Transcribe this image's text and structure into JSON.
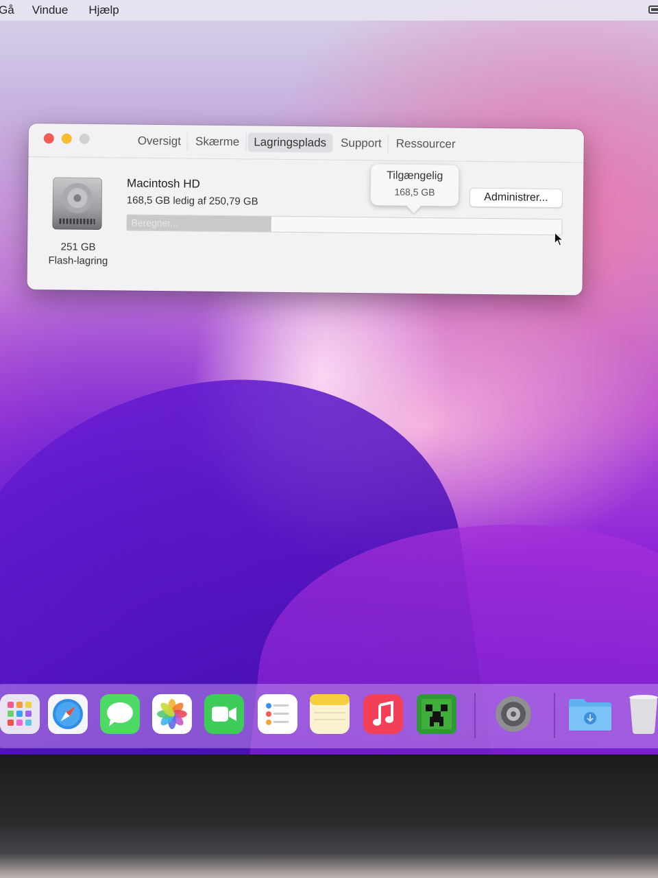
{
  "menubar": {
    "items": [
      "Gå",
      "Vindue",
      "Hjælp"
    ]
  },
  "window": {
    "tabs": [
      "Oversigt",
      "Skærme",
      "Lagringsplads",
      "Support",
      "Ressourcer"
    ],
    "active_tab": "Lagringsplads",
    "disk": {
      "icon": "hard-drive-icon",
      "capacity": "251 GB",
      "type": "Flash-lagring"
    },
    "volume": {
      "name": "Macintosh HD",
      "free_text": "168,5 GB ledig af 250,79 GB",
      "bar_label": "Beregner...",
      "used_fraction": 0.33
    },
    "tooltip": {
      "title": "Tilgængelig",
      "value": "168,5 GB"
    },
    "manage_button": "Administrer..."
  },
  "dock": {
    "items": [
      "launchpad-icon",
      "safari-icon",
      "messages-icon",
      "photos-icon",
      "facetime-icon",
      "reminders-icon",
      "notes-icon",
      "music-icon",
      "minecraft-icon",
      "system-preferences-icon",
      "downloads-folder-icon",
      "trash-icon"
    ]
  },
  "colors": {
    "close": "#f15c55",
    "minimize": "#f6be2f",
    "zoom_inactive": "#d2d0d3",
    "wallpaper_primary": "#8a22d8"
  }
}
